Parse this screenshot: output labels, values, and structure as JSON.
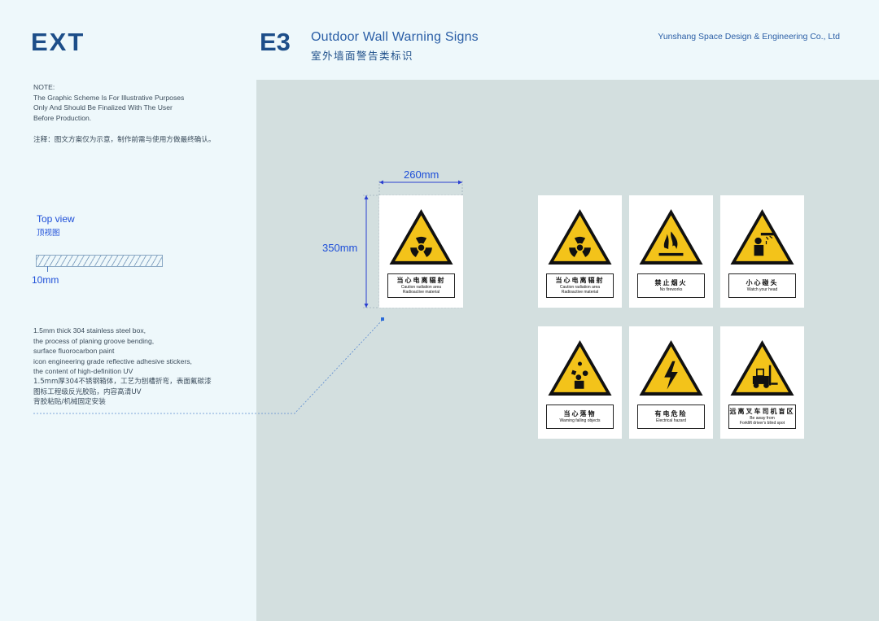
{
  "header": {
    "ext": "EXT",
    "code": "E3",
    "title_en": "Outdoor Wall Warning Signs",
    "title_cn": "室外墙面警告类标识",
    "company": "Yunshang Space Design & Engineering Co., Ltd"
  },
  "note": {
    "lines": [
      "NOTE:",
      "The Graphic Scheme Is For Illustrative Purposes",
      "Only And Should Be Finalized With The User",
      "Before Production."
    ],
    "cn": "注释：图文方案仅为示意，制作前需与使用方做最终确认。"
  },
  "topview": {
    "label": "Top view",
    "label_cn": "顶视图",
    "thickness": "10mm"
  },
  "spec": {
    "lines": [
      "1.5mm thick 304 stainless steel box,",
      "the process of planing groove bending,",
      "surface fluorocarbon paint",
      "icon engineering grade reflective adhesive stickers,",
      "the content of high-definition UV"
    ],
    "cn_lines": [
      "1.5mm厚304不锈钢箱体，工艺为刨槽折弯，表面氟碳漆",
      "图标工程级反光胶贴，内容高清UV",
      "背胶粘贴/机械固定安装"
    ]
  },
  "dimensions": {
    "width": "260mm",
    "height": "350mm"
  },
  "colors": {
    "sign_yellow": "#f3c31a",
    "panel": "#d3dfdf",
    "accent": "#1d4e89"
  },
  "signs": [
    {
      "icon": "radiation-icon",
      "cn": "当心电离辐射",
      "en": [
        "Caution radiation area",
        "Radioactive material"
      ]
    },
    {
      "icon": "radiation-icon",
      "cn": "当心电离辐射",
      "en": [
        "Caution radiation area",
        "Radioactive material"
      ]
    },
    {
      "icon": "fire-icon",
      "cn": "禁止烟火",
      "en": [
        "No fireworks"
      ]
    },
    {
      "icon": "head-bump-icon",
      "cn": "小心碰头",
      "en": [
        "Watch your head"
      ]
    },
    {
      "icon": "falling-objects-icon",
      "cn": "当心落物",
      "en": [
        "Warning falling objects"
      ]
    },
    {
      "icon": "electric-icon",
      "cn": "有电危险",
      "en": [
        "Electrical hazard"
      ]
    },
    {
      "icon": "forklift-icon",
      "cn": "远离叉车司机盲区",
      "en": [
        "Be away from",
        "Forklift driver's blind spot"
      ]
    }
  ]
}
